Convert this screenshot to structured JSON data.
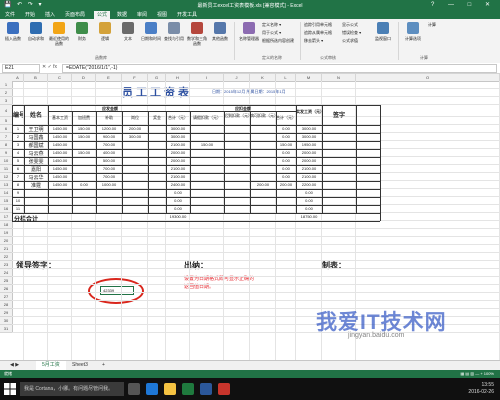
{
  "window": {
    "title": "最新员工excel工资表模板.xls [兼容模式] - Excel",
    "controls": [
      "?",
      "—",
      "□",
      "✕"
    ]
  },
  "quick_access": "💾 ↶ ↷ ▾",
  "tabs": [
    "文件",
    "开始",
    "插入",
    "页面布局",
    "公式",
    "数据",
    "审阅",
    "视图",
    "开发工具"
  ],
  "active_tab": "公式",
  "ribbon": {
    "buttons": [
      {
        "label": "插入函数",
        "color": "#3b6fbf"
      },
      {
        "label": "自动求和",
        "color": "#2f6db1"
      },
      {
        "label": "最近使用的函数",
        "color": "#f2a516"
      },
      {
        "label": "财务",
        "color": "#3f8d4a"
      },
      {
        "label": "逻辑",
        "color": "#d4a23a"
      },
      {
        "label": "文本",
        "color": "#6a6a6a"
      },
      {
        "label": "日期和时间",
        "color": "#4b7fc6"
      },
      {
        "label": "查找与引用",
        "color": "#7a8da8"
      },
      {
        "label": "数学和三角函数",
        "color": "#b5473d"
      },
      {
        "label": "其他函数",
        "color": "#5577aa"
      },
      {
        "label": "名称管理器",
        "color": "#8c6bb1"
      }
    ],
    "name_tools": [
      "定义名称 ▾",
      "用于公式 ▾",
      "根据所选内容创建"
    ],
    "audit_tools": [
      "追踪引用单元格",
      "追踪从属单元格",
      "移去箭头 ▾"
    ],
    "audit_tools2": [
      "显示公式",
      "错误检查 ▾",
      "公式求值"
    ],
    "watch": "监视窗口",
    "calc": [
      "计算选项",
      "计算"
    ],
    "groups": [
      "函数库",
      "定义的名称",
      "公式审核",
      "计算"
    ]
  },
  "formula_bar": {
    "name_box": "E21",
    "icons": "✕ ✓ fx",
    "formula": "=EDATE(\"2016/1/1\",-1)"
  },
  "sheet": {
    "columns": [
      "A",
      "B",
      "C",
      "D",
      "E",
      "F",
      "G",
      "H",
      "I",
      "J",
      "K",
      "L",
      "M",
      "N",
      "O"
    ],
    "rows": [
      "1",
      "2",
      "3",
      "4",
      "5",
      "6",
      "7",
      "8",
      "9",
      "10",
      "11",
      "12",
      "13",
      "14",
      "15",
      "16",
      "17",
      "18",
      "19",
      "20",
      "21",
      "22",
      "23",
      "24",
      "25",
      "26",
      "27",
      "28",
      "29",
      "30",
      "31"
    ],
    "title": "员工工资表",
    "date_line": "日期：2015年12月   所属日期：2015年1月",
    "headers": {
      "id": "编号",
      "name": "姓名",
      "income": "应发金额",
      "deduct": "应扣金额",
      "base": "基本工资",
      "overtime": "加班费",
      "subsidy": "补助",
      "post": "岗位",
      "bonus": "奖金",
      "subtotal": "合计（元）",
      "leave": "请假扣款（元）",
      "late": "迟到扣款（元）",
      "lunch": "病可扣款（元）",
      "total_ded": "合计（元）",
      "net": "实发工资（元）",
      "sign": "签字"
    },
    "rows_data": [
      {
        "id": "1",
        "name": "王卫明",
        "base": "1450.00",
        "overtime": "150.00",
        "subsidy": "1200.00",
        "post": "200.00",
        "bonus": "",
        "subtotal": "3000.00",
        "leave": "",
        "late": "",
        "lunch": "",
        "total_ded": "0.00",
        "net": "3000.00"
      },
      {
        "id": "2",
        "name": "马国鑫",
        "base": "1450.00",
        "overtime": "150.00",
        "subsidy": "900.00",
        "post": "300.00",
        "bonus": "",
        "subtotal": "3000.00",
        "leave": "",
        "late": "",
        "lunch": "",
        "total_ded": "0.00",
        "net": "3000.00"
      },
      {
        "id": "3",
        "name": "郝国斌",
        "base": "1450.00",
        "overtime": "",
        "subsidy": "700.00",
        "post": "",
        "bonus": "",
        "subtotal": "2100.00",
        "leave": "150.00",
        "late": "",
        "lunch": "",
        "total_ded": "150.00",
        "net": "1950.00"
      },
      {
        "id": "4",
        "name": "马云燕",
        "base": "1450.00",
        "overtime": "150.00",
        "subsidy": "400.00",
        "post": "",
        "bonus": "",
        "subtotal": "2000.00",
        "leave": "",
        "late": "",
        "lunch": "",
        "total_ded": "0.00",
        "net": "2000.00"
      },
      {
        "id": "5",
        "name": "张雯雯",
        "base": "1450.00",
        "overtime": "",
        "subsidy": "500.00",
        "post": "",
        "bonus": "",
        "subtotal": "2000.00",
        "leave": "",
        "late": "",
        "lunch": "",
        "total_ded": "0.00",
        "net": "2000.00"
      },
      {
        "id": "6",
        "name": "嘉阳",
        "base": "1450.00",
        "overtime": "",
        "subsidy": "700.00",
        "post": "",
        "bonus": "",
        "subtotal": "2100.00",
        "leave": "",
        "late": "",
        "lunch": "",
        "total_ded": "0.00",
        "net": "2100.00"
      },
      {
        "id": "7",
        "name": "马云华",
        "base": "1450.00",
        "overtime": "",
        "subsidy": "700.00",
        "post": "",
        "bonus": "",
        "subtotal": "2100.00",
        "leave": "",
        "late": "",
        "lunch": "",
        "total_ded": "0.00",
        "net": "2100.00"
      },
      {
        "id": "8",
        "name": "准霆",
        "base": "1450.00",
        "overtime": "0.00",
        "subsidy": "1000.00",
        "post": "",
        "bonus": "",
        "subtotal": "2400.00",
        "leave": "",
        "late": "",
        "lunch": "200.00",
        "total_ded": "200.00",
        "net": "2200.00"
      },
      {
        "id": "9",
        "name": "",
        "base": "",
        "overtime": "",
        "subsidy": "",
        "post": "",
        "bonus": "",
        "subtotal": "0.00",
        "leave": "",
        "late": "",
        "lunch": "",
        "total_ded": "",
        "net": "0.00"
      },
      {
        "id": "10",
        "name": "",
        "base": "",
        "overtime": "",
        "subsidy": "",
        "post": "",
        "bonus": "",
        "subtotal": "0.00",
        "leave": "",
        "late": "",
        "lunch": "",
        "total_ded": "",
        "net": "0.00"
      },
      {
        "id": "11",
        "name": "",
        "base": "",
        "overtime": "",
        "subsidy": "",
        "post": "",
        "bonus": "",
        "subtotal": "0.00",
        "leave": "",
        "late": "",
        "lunch": "",
        "total_ded": "",
        "net": "0.00"
      }
    ],
    "total_row": {
      "label": "分栏合计",
      "subtotal": "19300.00",
      "net": "18750.00"
    },
    "signatures": {
      "leader": "领导签字：",
      "cashier": "出纳：",
      "preparer": "制表："
    },
    "annotation_line1": "设置为日期格式即可显示正确的",
    "annotation_line2": "返回值日期。",
    "selected_cell_value": "42339"
  },
  "sheet_tabs": [
    "5月工资",
    "Sheet3",
    "+"
  ],
  "statusbar": {
    "left": "就绪",
    "right": "▦ ▤ ▥  —  +  100%"
  },
  "taskbar": {
    "search": "我是 Cortana，小娜。有问题尽管问我。",
    "time": "13:55",
    "date": "2016-02-26"
  },
  "watermark": {
    "text": "我爱IT技术网",
    "sub": "jingyan.baidu.com"
  }
}
